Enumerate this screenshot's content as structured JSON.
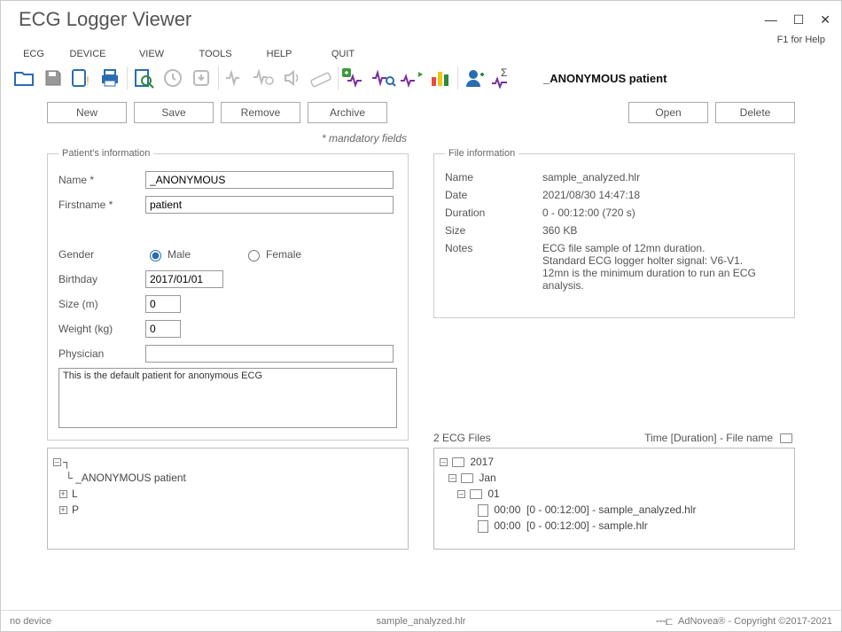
{
  "title": "ECG Logger Viewer",
  "help_hint": "F1 for Help",
  "menu": [
    "ECG",
    "DEVICE",
    "VIEW",
    "TOOLS",
    "HELP",
    "QUIT"
  ],
  "toolbar_patient": "_ANONYMOUS patient",
  "buttons": {
    "new": "New",
    "save": "Save",
    "remove": "Remove",
    "archive": "Archive",
    "open": "Open",
    "delete": "Delete"
  },
  "mandatory_note": "* mandatory fields",
  "patient_legend": "Patient's information",
  "file_legend": "File information",
  "labels": {
    "name": "Name *",
    "firstname": "Firstname *",
    "gender": "Gender",
    "birthday": "Birthday",
    "size": "Size (m)",
    "weight": "Weight (kg)",
    "physician": "Physician",
    "male": "Male",
    "female": "Female"
  },
  "patient": {
    "name": "_ANONYMOUS",
    "firstname": "patient",
    "gender": "male",
    "birthday": "2017/01/01",
    "size": "0",
    "weight": "0",
    "physician": "",
    "description": "This is the default patient for anonymous ECG"
  },
  "file_labels": {
    "name": "Name",
    "date": "Date",
    "duration": "Duration",
    "size": "Size",
    "notes": "Notes"
  },
  "file": {
    "name": "sample_analyzed.hlr",
    "date": "2021/08/30  14:47:18",
    "duration": "0 - 00:12:00 (720 s)",
    "size": "360 KB",
    "notes": "ECG file sample of 12mn duration.\nStandard ECG logger holter signal: V6-V1.\n12mn is the minimum duration to run an ECG analysis."
  },
  "patient_tree": {
    "root": "_ANONYMOUS patient",
    "children": [
      "L",
      "P"
    ]
  },
  "ecg_header": {
    "count": "2 ECG Files",
    "sort": "Time [Duration] - File name"
  },
  "ecg_tree": {
    "year": "2017",
    "month": "Jan",
    "day": "01",
    "files": [
      "00:00  [0 - 00:12:00] - sample_analyzed.hlr",
      "00:00  [0 - 00:12:00] - sample.hlr"
    ]
  },
  "status": {
    "left": "no device",
    "center": "sample_analyzed.hlr",
    "right": "AdNovea® - Copyright ©2017-2021"
  }
}
